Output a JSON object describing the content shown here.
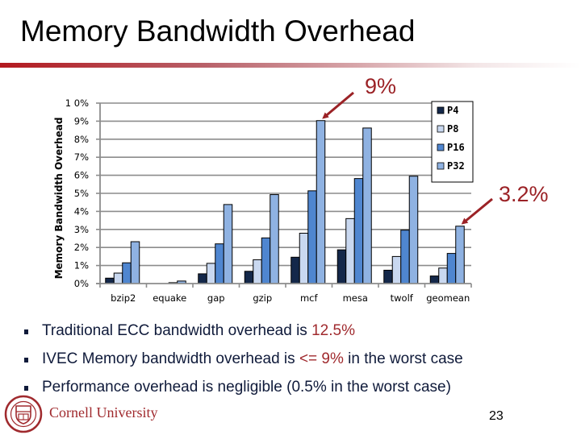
{
  "slide": {
    "title": "Memory Bandwidth Overhead",
    "page_number": "23",
    "institution": "Cornell University"
  },
  "bullets": [
    {
      "parts": [
        {
          "text": "Traditional ECC bandwidth overhead is "
        },
        {
          "text": "12.5%",
          "highlight": true
        }
      ]
    },
    {
      "parts": [
        {
          "text": "IVEC Memory bandwidth overhead is "
        },
        {
          "text": "<= 9%",
          "highlight": true
        },
        {
          "text": " in the worst case"
        }
      ]
    },
    {
      "parts": [
        {
          "text": "Performance overhead is negligible (0.5% in the worst case)"
        }
      ]
    }
  ],
  "colors": {
    "accent_red": "#a02a2e",
    "text_navy": "#0f1a3a",
    "P4": "#14284a",
    "P8": "#c9d8f0",
    "P16": "#4f86d0",
    "P32": "#8fb2e2"
  },
  "chart_data": {
    "type": "bar",
    "title": "",
    "xlabel": "",
    "ylabel": "Memory Bandwidth Overhead",
    "ylim": [
      0,
      10
    ],
    "yticks": [
      0,
      1,
      2,
      3,
      4,
      5,
      6,
      7,
      8,
      9,
      10
    ],
    "ytick_labels": [
      "0%",
      "1%",
      "2%",
      "3%",
      "4%",
      "5%",
      "6%",
      "7%",
      "8%",
      "9%",
      "1 0%"
    ],
    "grid": true,
    "legend_position": "top-right",
    "categories": [
      "bzip2",
      "equake",
      "gap",
      "gzip",
      "mcf",
      "mesa",
      "twolf",
      "geomean"
    ],
    "series": [
      {
        "name": "P4",
        "values": [
          0.3,
          0.0,
          0.54,
          0.68,
          1.46,
          1.87,
          0.74,
          0.42
        ]
      },
      {
        "name": "P8",
        "values": [
          0.58,
          0.0,
          1.12,
          1.32,
          2.79,
          3.6,
          1.5,
          0.86
        ]
      },
      {
        "name": "P16",
        "values": [
          1.15,
          0.05,
          2.2,
          2.53,
          5.14,
          5.82,
          2.96,
          1.67
        ]
      },
      {
        "name": "P32",
        "values": [
          2.32,
          0.14,
          4.38,
          4.93,
          9.03,
          8.62,
          5.95,
          3.18
        ]
      }
    ],
    "annotations": [
      {
        "text": "9%",
        "target_category": "mcf",
        "target_series": "P32"
      },
      {
        "text": "3.2%",
        "target_category": "geomean",
        "target_series": "P32"
      }
    ]
  }
}
